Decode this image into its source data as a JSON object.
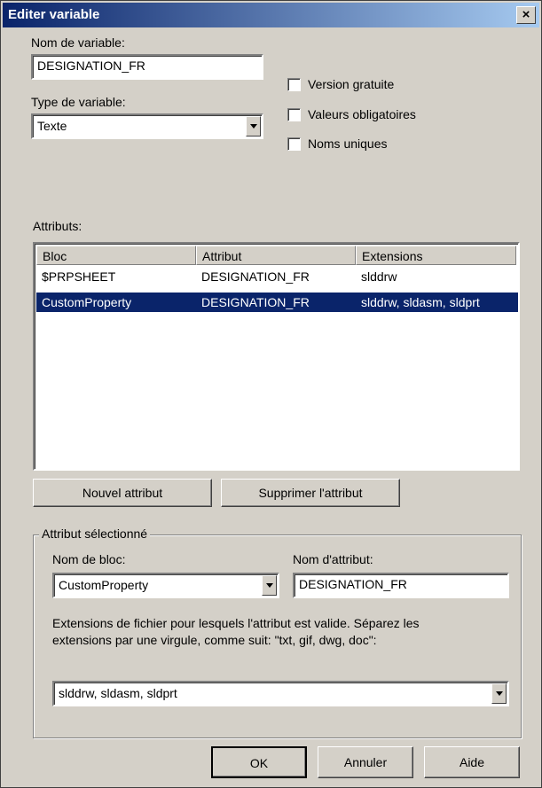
{
  "window": {
    "title": "Editer variable",
    "close": "×"
  },
  "fields": {
    "name_label": "Nom de variable:",
    "name_value": "DESIGNATION_FR",
    "type_label": "Type de variable:",
    "type_value": "Texte"
  },
  "checkboxes": [
    {
      "label": "Version gratuite",
      "checked": false
    },
    {
      "label": "Valeurs obligatoires",
      "checked": false
    },
    {
      "label": "Noms uniques",
      "checked": false
    }
  ],
  "attributes": {
    "label": "Attributs:",
    "columns": [
      "Bloc",
      "Attribut",
      "Extensions"
    ],
    "rows": [
      {
        "bloc": "$PRPSHEET",
        "attribut": "DESIGNATION_FR",
        "extensions": "slddrw",
        "selected": false
      },
      {
        "bloc": "CustomProperty",
        "attribut": "DESIGNATION_FR",
        "extensions": "slddrw, sldasm, sldprt",
        "selected": true
      }
    ],
    "new_button": "Nouvel attribut",
    "delete_button": "Supprimer l'attribut"
  },
  "selected_attribute": {
    "group_label": "Attribut sélectionné",
    "block_label": "Nom de bloc:",
    "block_value": "CustomProperty",
    "attr_label": "Nom d'attribut:",
    "attr_value": "DESIGNATION_FR",
    "help_line1": "Extensions de fichier pour lesquels l'attribut est valide. Séparez les",
    "help_line2": "extensions par une virgule, comme suit: \"txt, gif, dwg, doc\":",
    "extensions_value": "slddrw, sldasm, sldprt"
  },
  "buttons": {
    "ok": "OK",
    "cancel": "Annuler",
    "help": "Aide"
  },
  "colors": {
    "title_bar": "#0a246a",
    "selection": "#0a246a",
    "face": "#d4d0c8"
  }
}
